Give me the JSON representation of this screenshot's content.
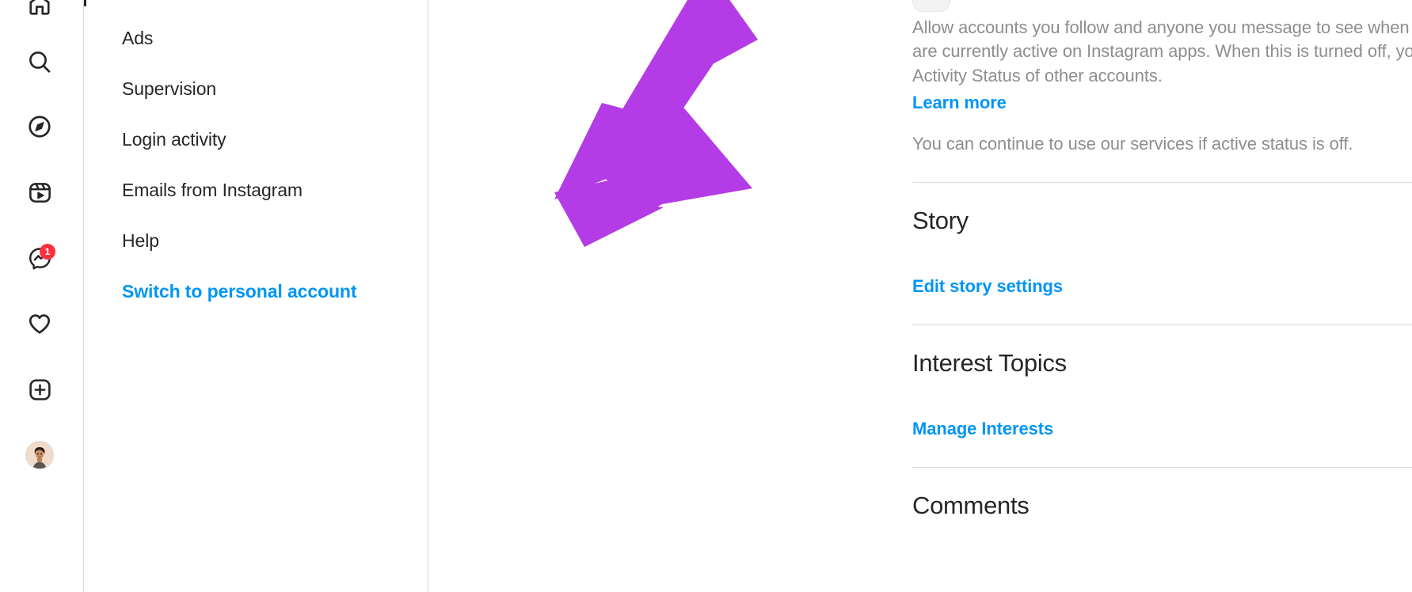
{
  "nav_rail": {
    "items": [
      {
        "name": "home",
        "icon": "home-icon",
        "label": "Home"
      },
      {
        "name": "search",
        "icon": "search-icon",
        "label": "Search"
      },
      {
        "name": "explore",
        "icon": "compass-icon",
        "label": "Explore"
      },
      {
        "name": "reels",
        "icon": "reels-icon",
        "label": "Reels"
      },
      {
        "name": "messages",
        "icon": "messenger-icon",
        "label": "Messages",
        "badge": "1"
      },
      {
        "name": "notifications",
        "icon": "heart-icon",
        "label": "Notifications"
      },
      {
        "name": "create",
        "icon": "plus-square-icon",
        "label": "Create"
      },
      {
        "name": "profile",
        "icon": "avatar",
        "label": "Profile"
      }
    ],
    "badge_color": "#ff3040"
  },
  "settings_menu": {
    "items": [
      {
        "label": "Ads",
        "selected": false,
        "highlight": false
      },
      {
        "label": "Supervision",
        "selected": false,
        "highlight": false
      },
      {
        "label": "Login activity",
        "selected": false,
        "highlight": false
      },
      {
        "label": "Emails from Instagram",
        "selected": false,
        "highlight": false
      },
      {
        "label": "Help",
        "selected": false,
        "highlight": false
      },
      {
        "label": "Switch to personal account",
        "selected": false,
        "highlight": true
      }
    ],
    "selected_indicator_color": "#262626"
  },
  "main": {
    "activity_status": {
      "description": "Allow accounts you follow and anyone you message to see when you were last active or are currently active on Instagram apps. When this is turned off, you won't be able to see the Activity Status of other accounts.",
      "learn_more": "Learn more",
      "note": "You can continue to use our services if active status is off."
    },
    "sections": [
      {
        "title": "Story",
        "link": "Edit story settings"
      },
      {
        "title": "Interest Topics",
        "link": "Manage Interests"
      },
      {
        "title": "Comments",
        "link": ""
      }
    ]
  },
  "colors": {
    "link_blue": "#0095f6",
    "text_primary": "#262626",
    "text_secondary": "#8e8e8e",
    "divider": "#dbdbdb",
    "annotation_arrow": "#b43ce6"
  },
  "annotation": {
    "type": "arrow",
    "points_to": "Edit story settings",
    "color": "#b43ce6"
  }
}
